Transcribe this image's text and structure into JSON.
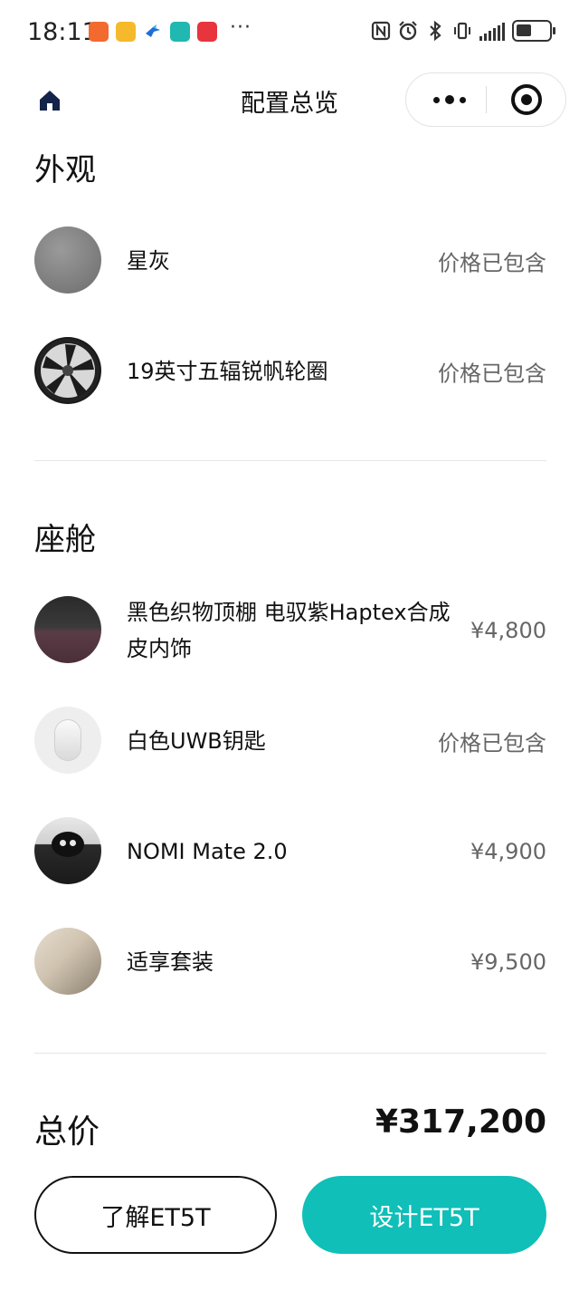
{
  "status_bar": {
    "time": "18:11",
    "more": "···"
  },
  "header": {
    "title": "配置总览"
  },
  "sections": {
    "exterior": {
      "title": "外观",
      "items": [
        {
          "name": "星灰",
          "price": "价格已包含"
        },
        {
          "name": "19英寸五辐锐帆轮圈",
          "price": "价格已包含"
        }
      ]
    },
    "cabin": {
      "title": "座舱",
      "items": [
        {
          "name": "黑色织物顶棚 电驭紫Haptex合成皮内饰",
          "price": "¥4,800"
        },
        {
          "name": "白色UWB钥匙",
          "price": "价格已包含"
        },
        {
          "name": "NOMI Mate 2.0",
          "price": "¥4,900"
        },
        {
          "name": "适享套装",
          "price": "¥9,500"
        }
      ]
    }
  },
  "total": {
    "label": "总价",
    "value": "¥317,200"
  },
  "buttons": {
    "learn_label": "了解ET5T",
    "design_label": "设计ET5T"
  },
  "colors": {
    "accent": "#0fbfb8",
    "home_icon": "#14234a"
  }
}
